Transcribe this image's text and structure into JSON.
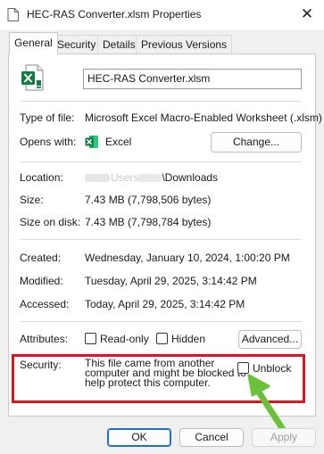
{
  "window": {
    "title": "HEC-RAS Converter.xlsm Properties",
    "close_glyph": "✕"
  },
  "tabs": [
    {
      "label": "General",
      "active": true
    },
    {
      "label": "Security",
      "active": false
    },
    {
      "label": "Details",
      "active": false
    },
    {
      "label": "Previous Versions",
      "active": false
    }
  ],
  "file": {
    "name": "HEC-RAS Converter.xlsm",
    "icon": "excel-file-icon"
  },
  "type_of_file": {
    "label": "Type of file:",
    "value": "Microsoft Excel Macro-Enabled Worksheet (.xlsm)"
  },
  "opens_with": {
    "label": "Opens with:",
    "value": "Excel",
    "icon": "excel-icon",
    "change_button": "Change..."
  },
  "location": {
    "label": "Location:",
    "visible_part": "Users",
    "value_suffix": "\\Downloads"
  },
  "size": {
    "label": "Size:",
    "value": "7.43 MB (7,798,506 bytes)"
  },
  "size_on_disk": {
    "label": "Size on disk:",
    "value": "7.43 MB (7,798,784 bytes)"
  },
  "created": {
    "label": "Created:",
    "value": "Wednesday, January 10, 2024, 1:00:20 PM"
  },
  "modified": {
    "label": "Modified:",
    "value": "Tuesday, April 29, 2025, 3:14:42 PM"
  },
  "accessed": {
    "label": "Accessed:",
    "value": "Today, April 29, 2025, 3:14:42 PM"
  },
  "attributes": {
    "label": "Attributes:",
    "read_only": {
      "label": "Read-only",
      "checked": false
    },
    "hidden": {
      "label": "Hidden",
      "checked": false
    },
    "advanced_button": "Advanced..."
  },
  "security": {
    "label": "Security:",
    "message_lines": [
      "This file came from another",
      "computer and might be blocked to",
      "help protect this computer."
    ],
    "unblock": {
      "label": "Unblock",
      "checked": false
    }
  },
  "footer": {
    "ok": "OK",
    "cancel": "Cancel",
    "apply": "Apply"
  },
  "annotation_colors": {
    "highlight_box": "#e0141e",
    "arrow": "#6cc13a"
  },
  "colors": {
    "excel_green": "#107c41",
    "default_button_border": "#1f6fcc"
  }
}
